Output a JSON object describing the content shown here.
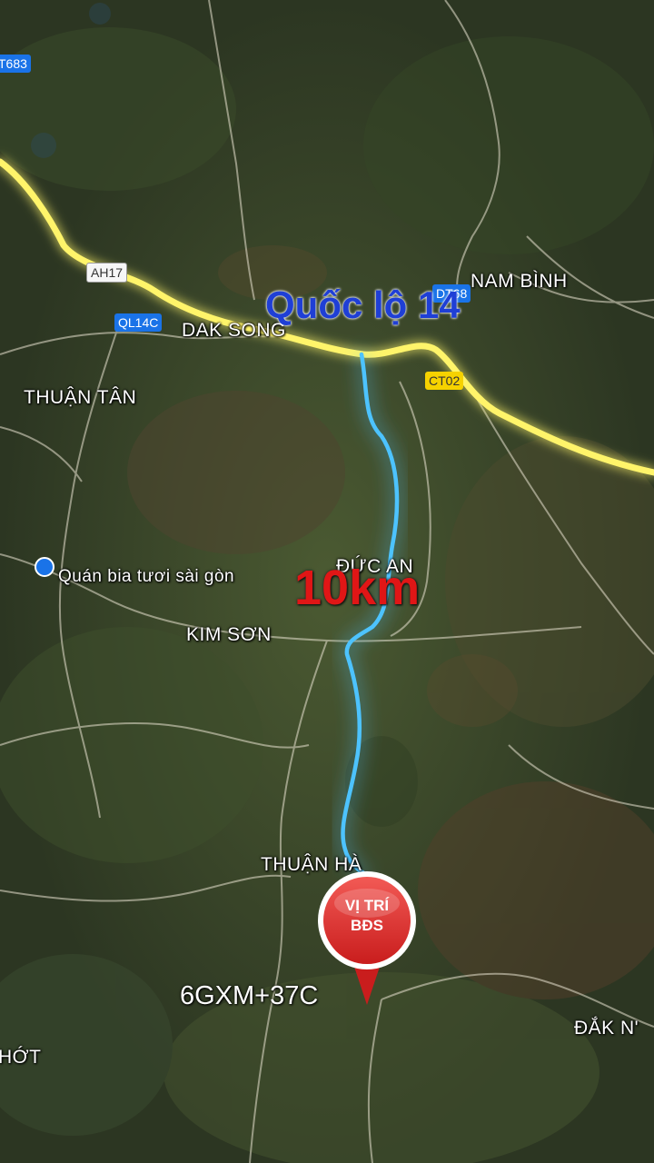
{
  "map": {
    "colors": {
      "highway": "#ffee33",
      "route": "#38b6ff",
      "title": "#1f3fd6",
      "distance": "#e01616",
      "pin": "#e53935"
    },
    "places": {
      "nam_binh": "NAM BÌNH",
      "dak_song": "DAK SONG",
      "thuan_tan": "THUẬN TÂN",
      "duc_an": "ĐỨC AN",
      "kim_son": "KIM SƠN",
      "thuan_ha": "THUẬN HÀ",
      "dak_n": "ĐẮK N'",
      "hot": "HỚT"
    },
    "shields": {
      "t683": "T683",
      "ah17": "AH17",
      "ql14c": "QL14C",
      "dt68": "DT68",
      "ct02": "CT02"
    },
    "poi": {
      "label": "Quán bia tươi sài gòn",
      "icon": "shopping-cart-icon"
    },
    "highway_title": "Quốc lộ 14",
    "distance_label": "10km",
    "pin": {
      "line1": "VỊ TRÍ",
      "line2": "BĐS",
      "icon": "location-pin-icon"
    },
    "plus_code": "6GXM+37C"
  }
}
